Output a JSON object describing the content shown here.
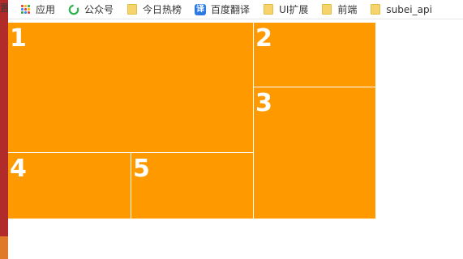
{
  "edge": {
    "glyph": "置"
  },
  "bookmarks": [
    {
      "label": "应用",
      "icon": "apps-grid-icon"
    },
    {
      "label": "公众号",
      "icon": "wechat-icon"
    },
    {
      "label": "今日热榜",
      "icon": "folder-icon"
    },
    {
      "label": "百度翻译",
      "icon": "translate-icon",
      "icon_text": "译"
    },
    {
      "label": "UI扩展",
      "icon": "folder-icon"
    },
    {
      "label": "前端",
      "icon": "folder-icon"
    },
    {
      "label": "subei_api",
      "icon": "folder-icon"
    }
  ],
  "layout": {
    "color": "#ff9900",
    "boxes": [
      {
        "label": "1"
      },
      {
        "label": "2"
      },
      {
        "label": "3"
      },
      {
        "label": "4"
      },
      {
        "label": "5"
      }
    ]
  }
}
